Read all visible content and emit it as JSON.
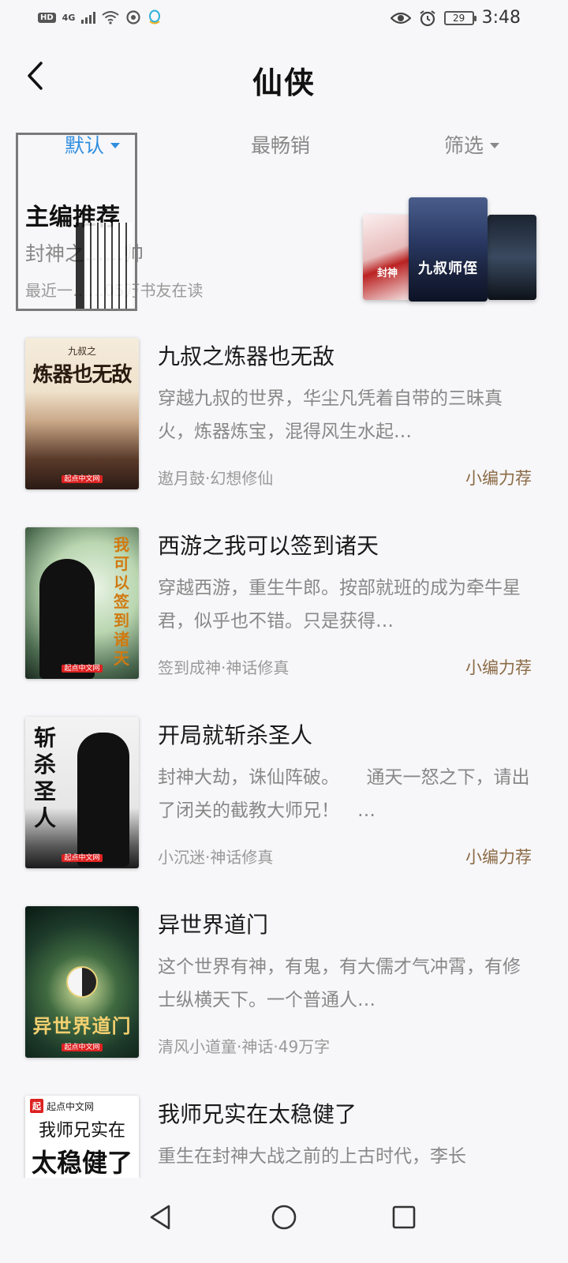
{
  "status_bar": {
    "hd": "HD",
    "network": "4G",
    "battery": "29",
    "time": "3:48"
  },
  "header": {
    "title": "仙侠"
  },
  "sort_tabs": [
    {
      "label": "默认",
      "active": true
    },
    {
      "label": "最畅销",
      "active": false
    },
    {
      "label": "筛选",
      "active": false
    }
  ],
  "editor_pick": {
    "title": "主编推荐",
    "subtitle": "封神之……帅",
    "readers": "最近一……05万书友在读",
    "stack_covers": [
      "九叔师侄",
      "封神"
    ]
  },
  "books": [
    {
      "title": "九叔之炼器也无敌",
      "desc": "穿越九叔的世界，华尘凡凭着自带的三昧真火，炼器炼宝，混得风生水起…",
      "meta": "遨月鼓·幻想修仙",
      "tag": "小编力荐",
      "cover_text": "炼器也无敌",
      "cover_sub": "九叔之"
    },
    {
      "title": "西游之我可以签到诸天",
      "desc": "穿越西游，重生牛郎。按部就班的成为牵牛星君，似乎也不错。只是获得…",
      "meta": "签到成神·神话修真",
      "tag": "小编力荐",
      "cover_text": "我可以签到诸天"
    },
    {
      "title": "开局就斩杀圣人",
      "desc": "封神大劫，诛仙阵破。　　通天一怒之下，请出了闭关的截教大师兄！　…",
      "meta": "小沉迷·神话修真",
      "tag": "小编力荐",
      "cover_text": "斩杀圣人"
    },
    {
      "title": "异世界道门",
      "desc": "这个世界有神，有鬼，有大儒才气冲霄，有修士纵横天下。一个普通人…",
      "meta": "清风小道童·神话·49万字",
      "tag": "",
      "cover_text": "异世界道门"
    },
    {
      "title": "我师兄实在太稳健了",
      "desc": "重生在封神大战之前的上古时代，李长",
      "meta": "",
      "tag": "",
      "cover_brand": "起点中文网",
      "cover_line1": "我师兄实在",
      "cover_line2": "太稳健了"
    }
  ],
  "cover_publisher": "起点中文网"
}
